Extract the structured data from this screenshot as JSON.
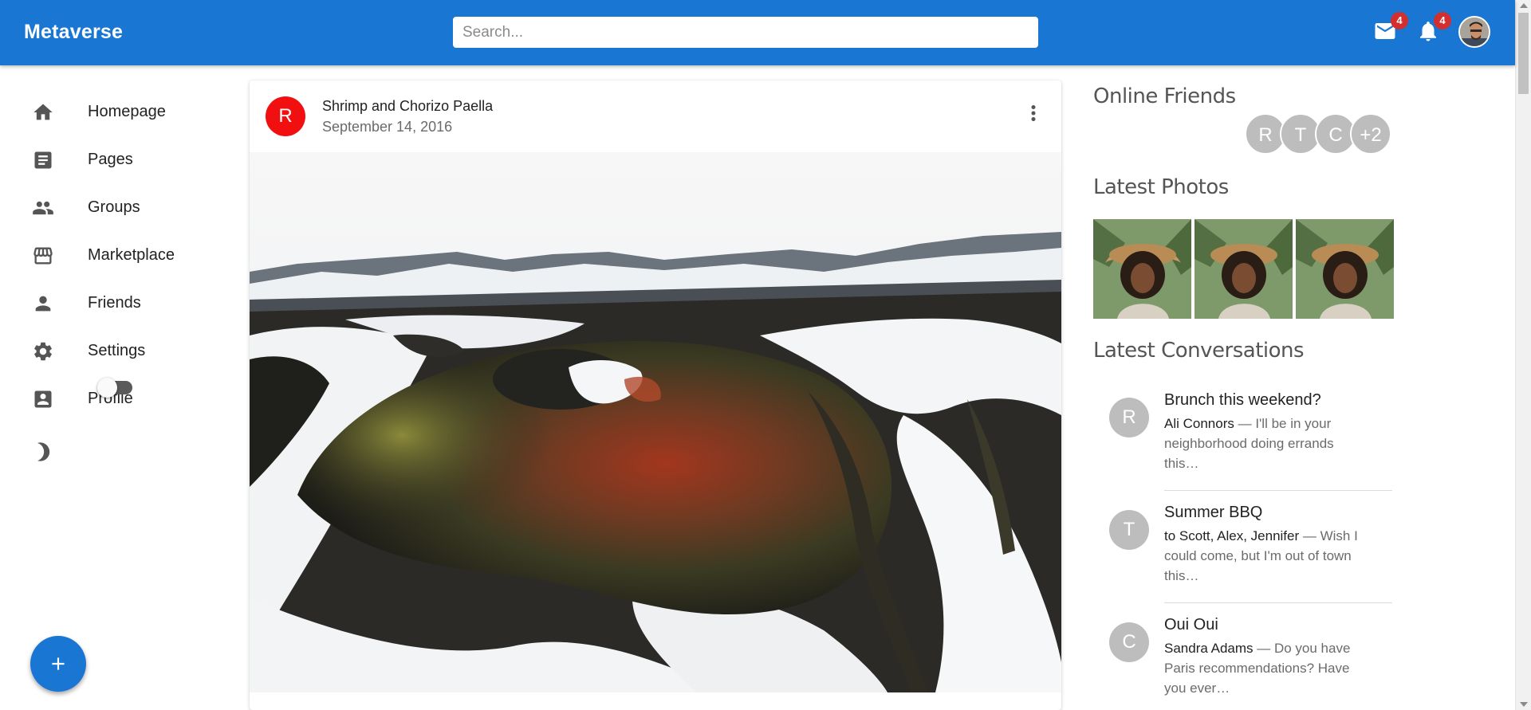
{
  "app": {
    "brand": "Metaverse"
  },
  "search": {
    "placeholder": "Search..."
  },
  "topbar": {
    "mail": {
      "icon": "mail-icon",
      "badge": "4"
    },
    "notifications": {
      "icon": "bell-icon",
      "badge": "4"
    },
    "avatar": {
      "icon": "user-avatar"
    }
  },
  "sidebar": {
    "items": [
      {
        "label": "Homepage",
        "icon": "home-icon"
      },
      {
        "label": "Pages",
        "icon": "article-icon"
      },
      {
        "label": "Groups",
        "icon": "group-icon"
      },
      {
        "label": "Marketplace",
        "icon": "storefront-icon"
      },
      {
        "label": "Friends",
        "icon": "person-icon"
      },
      {
        "label": "Settings",
        "icon": "gear-icon"
      },
      {
        "label": "Profile",
        "icon": "account-box-icon"
      }
    ],
    "theme_toggle": {
      "icon": "dark-mode-icon",
      "on": false
    },
    "fab": {
      "icon": "add-icon"
    }
  },
  "post": {
    "avatar_letter": "R",
    "title": "Shrimp and Chorizo Paella",
    "date": "September 14, 2016",
    "menu_icon": "more-vert-icon",
    "media": "snowy-volcanic-crater-photo"
  },
  "rightbar": {
    "online_friends_title": "Online Friends",
    "online_friends": [
      "R",
      "T",
      "C",
      "+2"
    ],
    "latest_photos_title": "Latest Photos",
    "latest_photos": [
      "woman-straw-hat-photo",
      "woman-straw-hat-photo",
      "woman-straw-hat-photo"
    ],
    "latest_conversations_title": "Latest Conversations",
    "conversations": [
      {
        "avatar": "R",
        "title": "Brunch this weekend?",
        "who": "Ali Connors",
        "text": " — I'll be in your neighborhood doing errands this…"
      },
      {
        "avatar": "T",
        "title": "Summer BBQ",
        "who": "to Scott, Alex, Jennifer",
        "text": " — Wish I could come, but I'm out of town this…"
      },
      {
        "avatar": "C",
        "title": "Oui Oui",
        "who": "Sandra Adams",
        "text": " — Do you have Paris recommendations? Have you ever…"
      }
    ]
  },
  "colors": {
    "appbar": "#1976d2",
    "badge": "#d32f2f",
    "post_avatar": "#f20f0f",
    "friend_avatar": "#bdbdbd"
  }
}
